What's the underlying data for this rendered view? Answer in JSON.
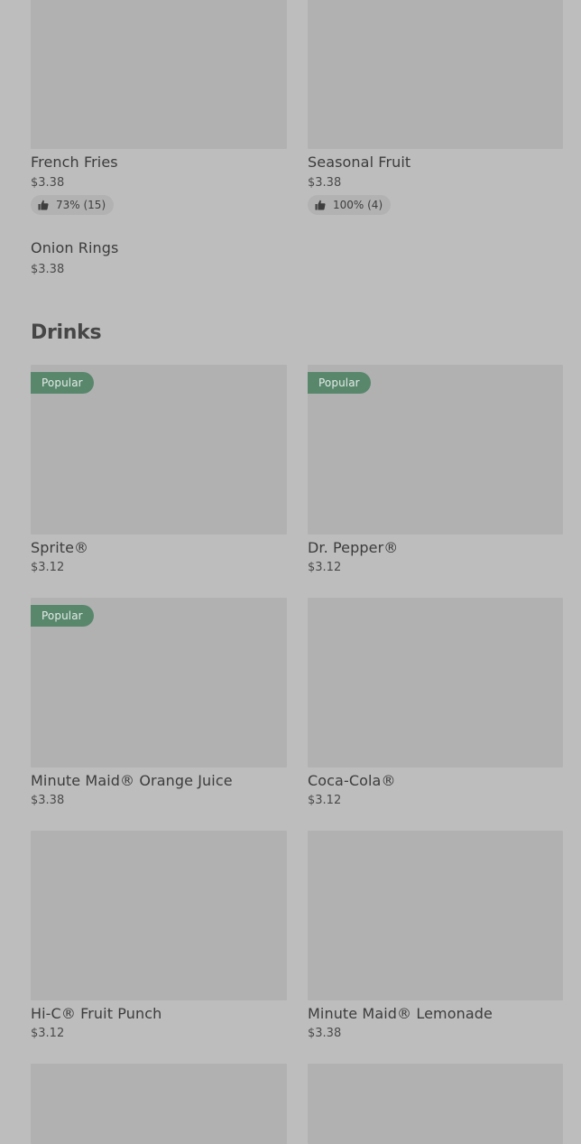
{
  "sides": {
    "french_fries": {
      "name": "French Fries",
      "price": "$3.38",
      "rating": "73% (15)"
    },
    "seasonal_fruit": {
      "name": "Seasonal Fruit",
      "price": "$3.38",
      "rating": "100% (4)"
    },
    "onion_rings": {
      "name": "Onion Rings",
      "price": "$3.38"
    }
  },
  "drinks": {
    "title": "Drinks",
    "popular_label": "Popular",
    "items": [
      {
        "name": "Sprite®",
        "price": "$3.12",
        "popular": true
      },
      {
        "name": "Dr. Pepper®",
        "price": "$3.12",
        "popular": true
      },
      {
        "name": "Minute Maid® Orange Juice",
        "price": "$3.38",
        "popular": true
      },
      {
        "name": "Coca-Cola®",
        "price": "$3.12",
        "popular": false
      },
      {
        "name": "Hi-C® Fruit Punch",
        "price": "$3.12",
        "popular": false
      },
      {
        "name": "Minute Maid® Lemonade",
        "price": "$3.38",
        "popular": false
      }
    ]
  },
  "icons": {
    "rating": "thumbs-up-icon"
  },
  "colors": {
    "background": "#bdbdbd",
    "image_placeholder": "#b1b1b1",
    "popular_badge": "#58876c",
    "rating_pill": "#b2b2b2",
    "text": "#3c3c3c"
  }
}
